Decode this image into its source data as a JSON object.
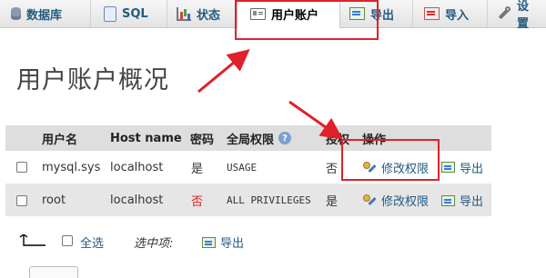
{
  "tabs": [
    {
      "label": "数据库",
      "icon": "database-icon"
    },
    {
      "label": "SQL",
      "icon": "sql-icon"
    },
    {
      "label": "状态",
      "icon": "status-icon"
    },
    {
      "label": "用户账户",
      "icon": "user-accounts-icon",
      "active": true
    },
    {
      "label": "导出",
      "icon": "export-icon"
    },
    {
      "label": "导入",
      "icon": "import-icon"
    },
    {
      "label": "设置",
      "icon": "wrench-icon"
    }
  ],
  "page_title": "用户账户概况",
  "table": {
    "headers": {
      "username": "用户名",
      "host": "Host name",
      "password": "密码",
      "privileges": "全局权限",
      "grant": "授权",
      "actions": "操作"
    },
    "rows": [
      {
        "username": "mysql.sys",
        "host": "localhost",
        "password": "是",
        "privileges": "USAGE",
        "grant": "否",
        "edit": "修改权限",
        "export": "导出"
      },
      {
        "username": "root",
        "host": "localhost",
        "password": "否",
        "privileges": "ALL PRIVILEGES",
        "grant": "是",
        "edit": "修改权限",
        "export": "导出"
      }
    ]
  },
  "footer": {
    "select_all": "全选",
    "selected_label": "选中项:",
    "export": "导出"
  },
  "colors": {
    "link": "#235a81",
    "annotation": "#e0202a",
    "password_no": "#d22222"
  }
}
